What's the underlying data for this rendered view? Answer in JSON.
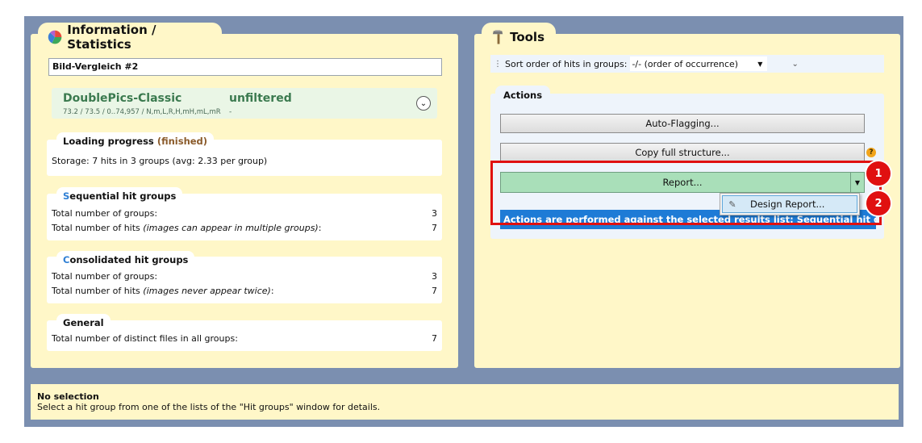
{
  "left": {
    "title": "Information / Statistics",
    "comparison_name": "Bild-Vergleich #2",
    "algorithm": {
      "name": "DoublePics-Classic",
      "params": "73.2 / 73.5 / 0..74,957 / N,m,L,R,H,mH,mL,mR",
      "filter": "unfiltered",
      "filter_sub": "-"
    },
    "loading": {
      "heading": "Loading progress",
      "status": "(finished)",
      "storage_text": "Storage: 7 hits in 3 groups (avg: 2.33 per group)"
    },
    "sequential": {
      "accent": "S",
      "heading_rest": "equential hit groups",
      "row1_label": "Total number of groups:",
      "row1_value": "3",
      "row2_label": "Total number of hits",
      "row2_note": "(images can appear in multiple groups)",
      "row2_colon": ":",
      "row2_value": "7"
    },
    "consolidated": {
      "accent": "C",
      "heading_rest": "onsolidated hit groups",
      "row1_label": "Total number of groups:",
      "row1_value": "3",
      "row2_label": "Total number of hits",
      "row2_note": "(images never appear twice)",
      "row2_colon": ":",
      "row2_value": "7"
    },
    "general": {
      "heading": "General",
      "row1_label": "Total number of distinct files in all groups:",
      "row1_value": "7"
    }
  },
  "right": {
    "title": "Tools",
    "sort_label": "Sort order of hits in groups:",
    "sort_value": "-/- (order of occurrence)",
    "actions_heading": "Actions",
    "buttons": {
      "auto_flagging": "Auto-Flagging...",
      "copy_structure": "Copy full structure...",
      "report": "Report..."
    },
    "help_symbol": "?",
    "info_text": "Actions are performed against the selected results list: Sequential hit groups",
    "dropdown_item": "Design Report..."
  },
  "annotations": {
    "badge1": "1",
    "badge2": "2",
    "color": "#e01010"
  },
  "status": {
    "title": "No selection",
    "message": "Select a hit group from one of the lists of the \"Hit groups\" window for details."
  },
  "colors": {
    "frame": "#7b8fb0",
    "panel": "#fff7c8",
    "report_button": "#a9dfb9",
    "info_bar": "#1e7bd6",
    "accent_green": "#3b7a4f"
  }
}
